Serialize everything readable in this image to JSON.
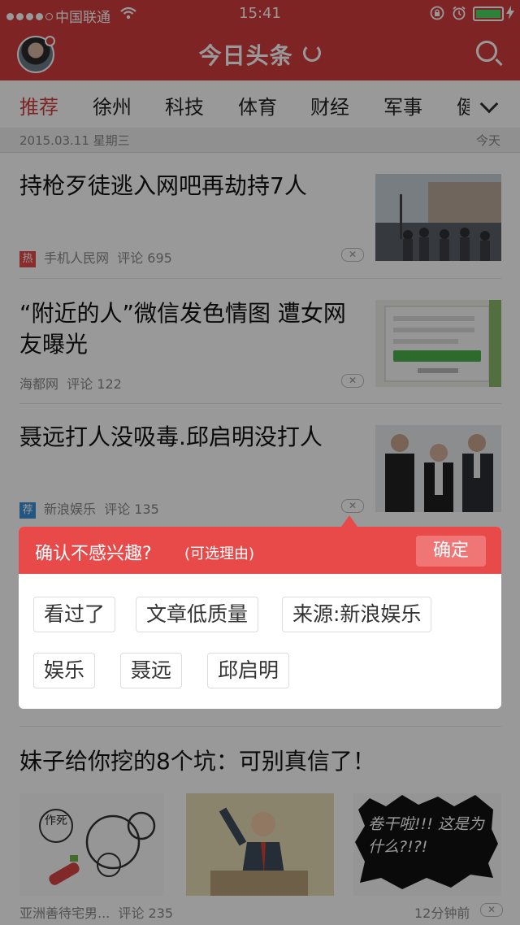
{
  "status_bar": {
    "carrier": "中国联通",
    "time": "15:41"
  },
  "header": {
    "title": "今日头条"
  },
  "tabs": [
    "推荐",
    "徐州",
    "科技",
    "体育",
    "财经",
    "军事",
    "健"
  ],
  "date_bar": {
    "date": "2015.03.11 星期三",
    "label": "今天"
  },
  "articles": [
    {
      "title": "持枪歹徒逃入网吧再劫持7人",
      "tag": "热",
      "tag_color": "#e84a4a",
      "source": "手机人民网",
      "comments": "评论 695"
    },
    {
      "title": "“附近的人”微信发色情图 遭女网友曝光",
      "source": "海都网",
      "comments": "评论 122"
    },
    {
      "title": "聂远打人没吸毒.邱启明没打人",
      "tag": "荐",
      "tag_color": "#3b8fd6",
      "source": "新浪娱乐",
      "comments": "评论 135"
    },
    {
      "title": "妹子给你挖的8个坑：可别真信了！",
      "source": "亚洲善待宅男...",
      "comments": "评论 235",
      "time": "12分钟前"
    }
  ],
  "comic_captions": [
    "作死",
    "卷干啦!!! 这是为什么?!?!"
  ],
  "popup": {
    "question": "确认不感兴趣?",
    "hint": "(可选理由)",
    "confirm": "确定",
    "reasons": [
      "看过了",
      "文章低质量",
      "来源:新浪娱乐",
      "娱乐",
      "聂远",
      "邱启明"
    ]
  },
  "colors": {
    "brand": "#d43d3d",
    "popup_header": "#e84a4a"
  }
}
